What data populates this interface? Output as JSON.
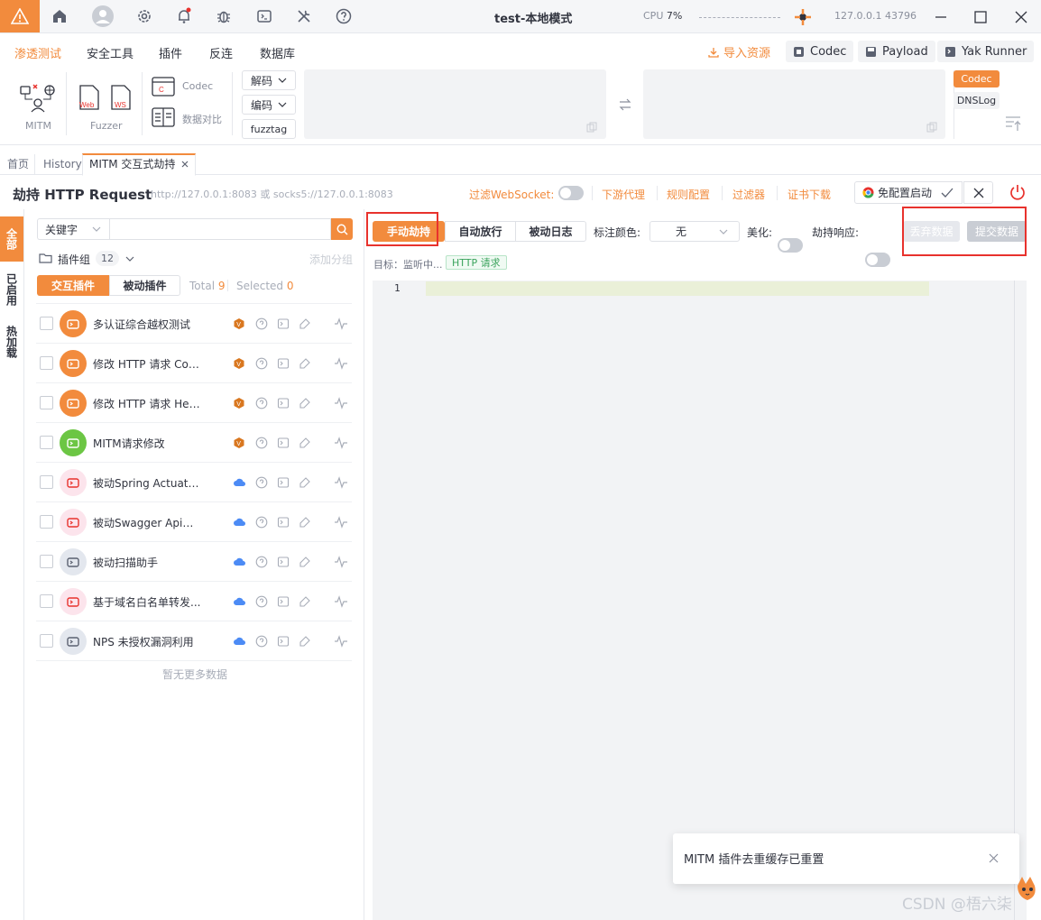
{
  "window": {
    "title": "test-本地模式",
    "cpu_label": "CPU",
    "cpu_value": "7%",
    "address": "127.0.0.1 43796"
  },
  "menu": {
    "items": [
      "渗透测试",
      "安全工具",
      "插件",
      "反连",
      "数据库"
    ],
    "right_buttons": {
      "import": "导入资源",
      "codec": "Codec",
      "payload": "Payload",
      "runner": "Yak Runner"
    },
    "tools": {
      "mitm": "MITM",
      "fuzzer": "Fuzzer",
      "web": "Web",
      "ws": "WS",
      "codec": "Codec",
      "compare": "数据对比"
    },
    "codec_panel": {
      "decode": "解码",
      "encode": "编码",
      "fuzztag": "fuzztag"
    },
    "side_tags": {
      "codec": "Codec",
      "dnslog": "DNSLog"
    }
  },
  "tabs": [
    "首页",
    "History",
    "MITM 交互式劫持"
  ],
  "header": {
    "title": "劫持 HTTP Request",
    "address": "http://127.0.0.1:8083 或 socks5://127.0.0.1:8083",
    "filter_ws": "过滤WebSocket:",
    "links": [
      "下游代理",
      "规则配置",
      "过滤器",
      "证书下载"
    ],
    "browser_btn": "免配置启动"
  },
  "left_tabs": [
    "全部",
    "已启用",
    "热加载"
  ],
  "search": {
    "select": "关键字",
    "placeholder": ""
  },
  "plugin_group": {
    "label": "插件组",
    "count": "12",
    "add": "添加分组"
  },
  "plugin_tabs": {
    "interactive": "交互插件",
    "passive": "被动插件",
    "total_label": "Total",
    "total": "9",
    "selected_label": "Selected",
    "selected": "0"
  },
  "plugins": [
    {
      "name": "多认证综合越权测试",
      "cloud": false
    },
    {
      "name": "修改 HTTP 请求 Coo...",
      "cloud": false
    },
    {
      "name": "修改 HTTP 请求 Hea...",
      "cloud": false
    },
    {
      "name": "MITM请求修改",
      "cloud": false
    },
    {
      "name": "被动Spring Actuator...",
      "cloud": true
    },
    {
      "name": "被动Swagger Api扫描",
      "cloud": true
    },
    {
      "name": "被动扫描助手",
      "cloud": true
    },
    {
      "name": "基于域名白名单转发...",
      "cloud": true
    },
    {
      "name": "NPS 未授权漏洞利用",
      "cloud": true
    }
  ],
  "no_more": "暂无更多数据",
  "editor": {
    "mode_buttons": [
      "手动劫持",
      "自动放行",
      "被动日志"
    ],
    "color_label": "标注颜色:",
    "color_value": "无",
    "beautify": "美化:",
    "hijack_resp": "劫持响应:",
    "drop": "丢弃数据",
    "submit": "提交数据",
    "target_label": "目标：监听中...",
    "tag": "HTTP 请求",
    "line": "1"
  },
  "toast": "MITM 插件去重缓存已重置",
  "watermark": "CSDN @梧六柒",
  "colors": {
    "accent": "#f28b3d",
    "highlight": "#e8322d"
  }
}
